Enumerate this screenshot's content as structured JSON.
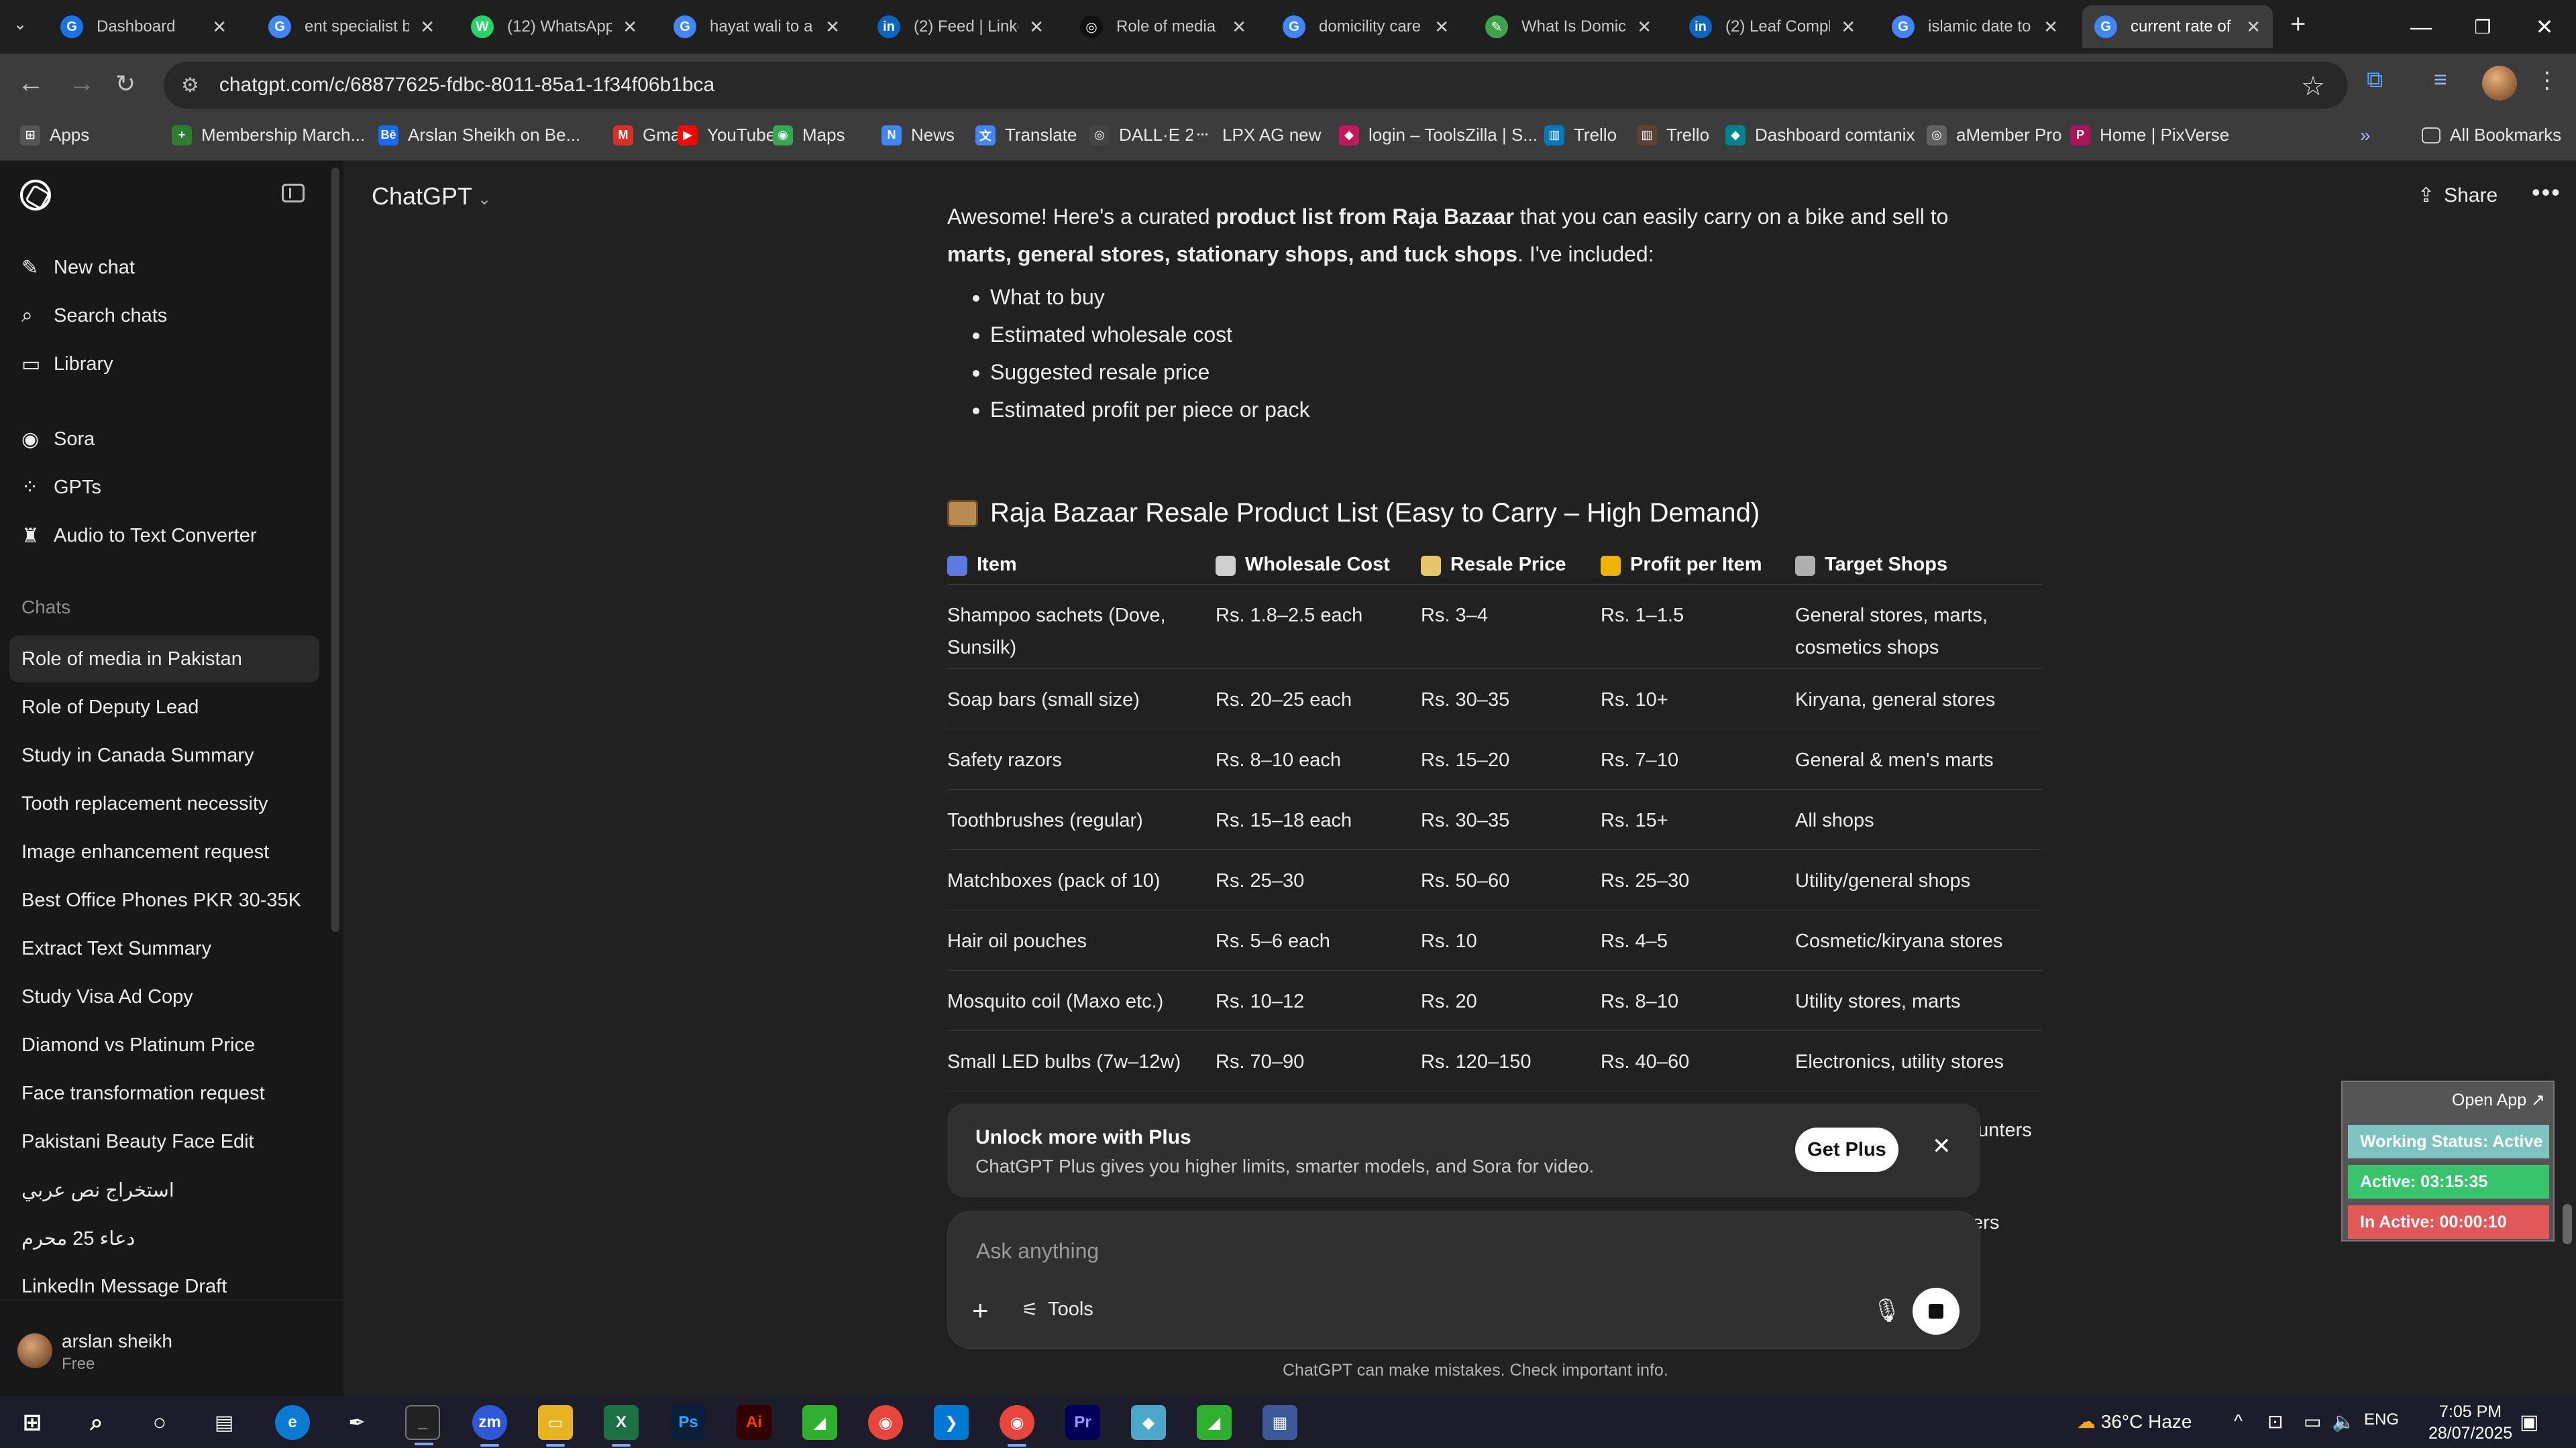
{
  "browser": {
    "tabs": [
      {
        "title": "Dashboard",
        "favicon": "G",
        "color": "#1a73e8"
      },
      {
        "title": "ent specialist b",
        "favicon": "G",
        "color": "#4285f4"
      },
      {
        "title": "(12) WhatsApp",
        "favicon": "W",
        "color": "#25d366"
      },
      {
        "title": "hayat wali to a",
        "favicon": "G",
        "color": "#4285f4"
      },
      {
        "title": "(2) Feed | Linke",
        "favicon": "in",
        "color": "#0a66c2"
      },
      {
        "title": "Role of media",
        "favicon": "◎",
        "color": "#111111"
      },
      {
        "title": "domicility care",
        "favicon": "G",
        "color": "#4285f4"
      },
      {
        "title": "What Is Domic",
        "favicon": "✎",
        "color": "#3fa34d"
      },
      {
        "title": "(2) Leaf Compl",
        "favicon": "in",
        "color": "#0a66c2"
      },
      {
        "title": "islamic date to",
        "favicon": "G",
        "color": "#4285f4"
      },
      {
        "title": "current rate of",
        "favicon": "G",
        "color": "#4285f4"
      }
    ],
    "url": "chatgpt.com/c/68877625-fdbc-8011-85a1-1f34f06b1bca",
    "bookmarks": [
      {
        "label": "Apps",
        "icon": "grid",
        "color": "#555555"
      },
      {
        "label": "Membership March...",
        "icon": "+",
        "color": "#2e7d32"
      },
      {
        "label": "Arslan Sheikh on Be...",
        "icon": "Bē",
        "color": "#1769ff"
      },
      {
        "label": "Gmail",
        "icon": "M",
        "color": "#d93025"
      },
      {
        "label": "YouTube",
        "icon": "▶",
        "color": "#ff0000"
      },
      {
        "label": "Maps",
        "icon": "◉",
        "color": "#34a853"
      },
      {
        "label": "News",
        "icon": "N",
        "color": "#4285f4"
      },
      {
        "label": "Translate",
        "icon": "文",
        "color": "#4285f4"
      },
      {
        "label": "DALL·E 2",
        "icon": "◎",
        "color": "#444444"
      },
      {
        "label": "LPX AG new",
        "icon": "···",
        "color": "#3c3c3c"
      },
      {
        "label": "login – ToolsZilla | S...",
        "icon": "◆",
        "color": "#c2185b"
      },
      {
        "label": "Trello",
        "icon": "▥",
        "color": "#0079bf"
      },
      {
        "label": "Trello",
        "icon": "▥",
        "color": "#5d4037"
      },
      {
        "label": "Dashboard comtanix",
        "icon": "◆",
        "color": "#00838f"
      },
      {
        "label": "aMember Pro",
        "icon": "◎",
        "color": "#616161"
      },
      {
        "label": "Home | PixVerse",
        "icon": "P",
        "color": "#ad1457"
      }
    ],
    "all_bookmarks": "All Bookmarks"
  },
  "sidebar": {
    "nav": [
      {
        "label": "New chat",
        "icon": "✎"
      },
      {
        "label": "Search chats",
        "icon": "⌕"
      },
      {
        "label": "Library",
        "icon": "▭"
      }
    ],
    "nav2": [
      {
        "label": "Sora",
        "icon": "◉"
      },
      {
        "label": "GPTs",
        "icon": "⁘"
      },
      {
        "label": "Audio to Text Converter",
        "icon": "♜"
      }
    ],
    "chats_label": "Chats",
    "chats": [
      "Role of media in Pakistan",
      "Role of Deputy Lead",
      "Study in Canada Summary",
      "Tooth replacement necessity",
      "Image enhancement request",
      "Best Office Phones PKR 30-35K",
      "Extract Text Summary",
      "Study Visa Ad Copy",
      "Diamond vs Platinum Price",
      "Face transformation request",
      "Pakistani Beauty Face Edit",
      "استخراج نص عربي",
      "دعاء 25 محرم",
      "LinkedIn Message Draft"
    ],
    "user": {
      "name": "arslan sheikh",
      "plan": "Free"
    }
  },
  "header": {
    "model": "ChatGPT",
    "share": "Share"
  },
  "message": {
    "intro_a": "Awesome! Here's a curated ",
    "intro_b": "product list from Raja Bazaar",
    "intro_c": " that you can easily carry on a bike and sell to",
    "intro_d": "marts, general stores, stationary shops, and tuck shops",
    "intro_e": ". I've included:",
    "bullets": [
      "What to buy",
      "Estimated wholesale cost",
      "Suggested resale price",
      "Estimated profit per piece or pack"
    ],
    "section_title": "Raja Bazaar Resale Product List (Easy to Carry – High Demand)",
    "table": {
      "headers": [
        "Item",
        "Wholesale Cost",
        "Resale Price",
        "Profit per Item",
        "Target Shops"
      ],
      "rows": [
        [
          "Shampoo sachets (Dove, Sunsilk)",
          "Rs. 1.8–2.5 each",
          "Rs. 3–4",
          "Rs. 1–1.5",
          "General stores, marts, cosmetics shops"
        ],
        [
          "Soap bars (small size)",
          "Rs. 20–25 each",
          "Rs. 30–35",
          "Rs. 10+",
          "Kiryana, general stores"
        ],
        [
          "Safety razors",
          "Rs. 8–10 each",
          "Rs. 15–20",
          "Rs. 7–10",
          "General & men's marts"
        ],
        [
          "Toothbrushes (regular)",
          "Rs. 15–18 each",
          "Rs. 30–35",
          "Rs. 15+",
          "All shops"
        ],
        [
          "Matchboxes (pack of 10)",
          "Rs. 25–30",
          "Rs. 50–60",
          "Rs. 25–30",
          "Utility/general shops"
        ],
        [
          "Hair oil pouches",
          "Rs. 5–6 each",
          "Rs. 10",
          "Rs. 4–5",
          "Cosmetic/kiryana stores"
        ],
        [
          "Mosquito coil (Maxo etc.)",
          "Rs. 10–12",
          "Rs. 20",
          "Rs. 8–10",
          "Utility stores, marts"
        ],
        [
          "Small LED bulbs (7w–12w)",
          "Rs. 70–90",
          "Rs. 120–150",
          "Rs. 40–60",
          "Electronics, utility stores"
        ]
      ],
      "peek_right_1": "ounters",
      "peek_right_2": "ters"
    }
  },
  "plus_banner": {
    "title": "Unlock more with Plus",
    "subtitle": "ChatGPT Plus gives you higher limits, smarter models, and Sora for video.",
    "button": "Get Plus"
  },
  "composer": {
    "placeholder": "Ask anything",
    "tools": "Tools"
  },
  "disclaimer": "ChatGPT can make mistakes. Check important info.",
  "widget": {
    "open_app": "Open App ↗",
    "working_status": "Working Status: Active",
    "active": "Active: 03:15:35",
    "inactive": "In Active: 00:00:10"
  },
  "taskbar": {
    "weather": "36°C  Haze",
    "lang": "ENG",
    "time": "7:05 PM",
    "date": "28/07/2025"
  }
}
